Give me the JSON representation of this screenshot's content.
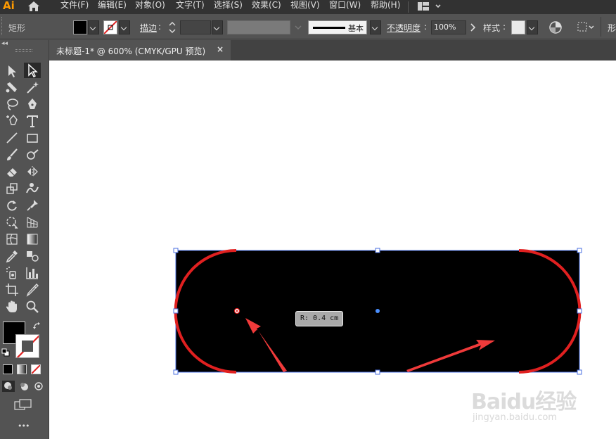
{
  "app": {
    "logo": "Ai"
  },
  "menu": [
    "文件(F)",
    "编辑(E)",
    "对象(O)",
    "文字(T)",
    "选择(S)",
    "效果(C)",
    "视图(V)",
    "窗口(W)",
    "帮助(H)"
  ],
  "control": {
    "object_type": "矩形",
    "stroke_label": "描边",
    "stroke_weight": "",
    "profile_label": "基本",
    "opacity_label": "不透明度",
    "opacity_value": "100%",
    "style_label": "样式",
    "shape_label": "形"
  },
  "document": {
    "tab_title": "未标题-1* @ 600% (CMYK/GPU 预览)",
    "close_glyph": "×"
  },
  "canvas": {
    "tooltip": "R: 0.4 cm",
    "watermark_brand": "Baidu经验",
    "watermark_url": "jingyan.baidu.com"
  },
  "toolbar": {
    "more": "•••"
  },
  "colors": {
    "ui_dark": "#323232",
    "ui_mid": "#535353",
    "accent_logo": "#ff9a00",
    "selection": "#4a6fe0",
    "annotation_red": "#e02020",
    "arrow_red": "#f03a3a",
    "shape_fill": "#000000"
  }
}
